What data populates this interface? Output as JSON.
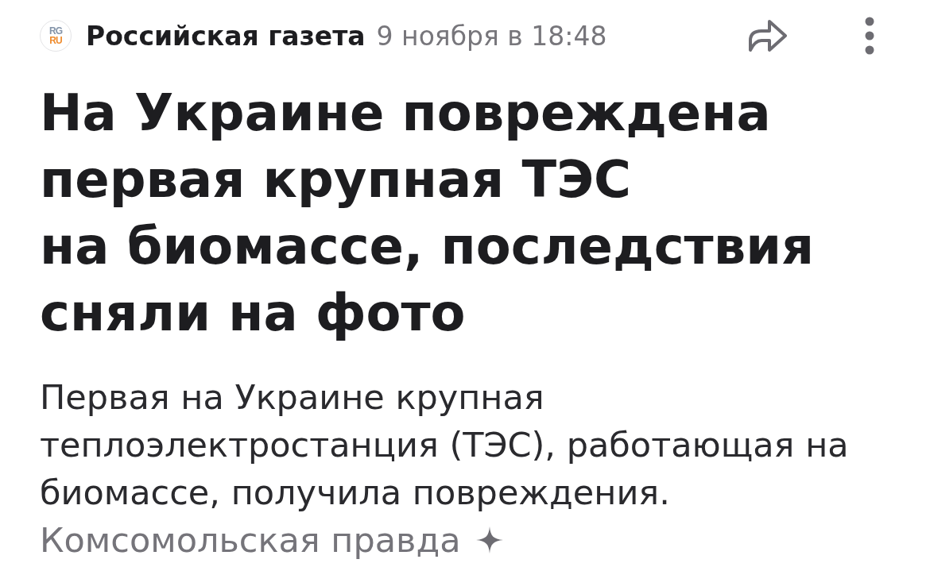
{
  "header": {
    "logo": [
      "RG",
      "RU"
    ],
    "source": "Российская газета",
    "time": "9 ноября в 18:48"
  },
  "headline": "На Украине повреждена первая крупная ТЭС на биомассе, последствия сняли на фото",
  "summary": "Первая на Украине крупная теплоэлектростанция (ТЭС), работающая на биомассе, получила повреждения.",
  "attribution": {
    "source": "Комсомольская правда"
  }
}
